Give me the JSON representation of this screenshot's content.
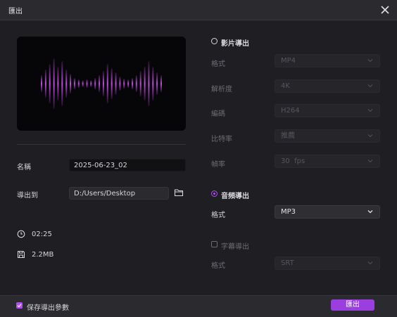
{
  "window": {
    "title": "匯出"
  },
  "left": {
    "name_label": "名稱",
    "name_value": "2025-06-23_02",
    "export_to_label": "導出到",
    "path_value": "D:/Users/Desktop",
    "duration": "02:25",
    "file_size": "2.2MB"
  },
  "video_section": {
    "title": "影片導出",
    "selected": false,
    "format_label": "格式",
    "format_value": "MP4",
    "resolution_label": "解析度",
    "resolution_value": "4K",
    "codec_label": "編碼",
    "codec_value": "H264",
    "bitrate_label": "比特率",
    "bitrate_value": "推薦",
    "framerate_label": "幀率",
    "framerate_value": "30  fps"
  },
  "audio_section": {
    "title": "音頻導出",
    "selected": true,
    "format_label": "格式",
    "format_value": "MP3"
  },
  "subtitle_section": {
    "title": "字幕導出",
    "checked": false,
    "format_label": "格式",
    "format_value": "SRT"
  },
  "footer": {
    "save_params_label": "保存導出參數",
    "save_params_checked": true,
    "export_button": "匯出"
  },
  "colors": {
    "accent": "#9b3ee0",
    "waveform": "#c04ae0"
  },
  "waveform_levels": [
    0.3,
    0.5,
    0.7,
    0.9,
    0.6,
    0.8,
    0.5,
    0.35,
    0.2,
    0.15,
    0.12,
    0.15,
    0.12,
    0.2,
    0.3,
    0.45,
    0.7,
    0.55,
    0.4,
    0.25,
    0.18,
    0.15,
    0.2,
    0.3,
    0.45,
    0.6,
    0.8,
    0.6,
    0.4,
    0.3
  ]
}
